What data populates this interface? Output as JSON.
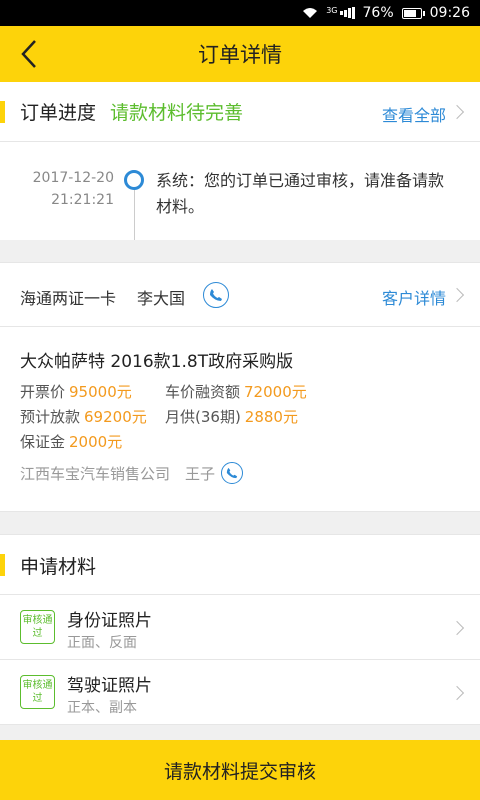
{
  "status_bar": {
    "network": "3G",
    "battery": "76%",
    "time": "09:26"
  },
  "nav": {
    "title": "订单详情",
    "back_icon": "chevron-left-icon"
  },
  "progress": {
    "label": "订单进度",
    "status": "请款材料待完善",
    "view_all": "查看全部",
    "colors": {
      "status": "#5cbd2e",
      "link": "#2d8ad6"
    }
  },
  "timeline": {
    "date": "2017-12-20",
    "time": "21:21:21",
    "message": "系统：您的订单已通过审核，请准备请款材料。"
  },
  "customer": {
    "org": "海通两证一卡",
    "name": "李大国",
    "detail_link": "客户详情",
    "car": "大众帕萨特 2016款1.8T政府采购版",
    "fields": {
      "invoice_label": "开票价",
      "invoice_value": "95000元",
      "finance_label": "车价融资额",
      "finance_value": "72000元",
      "loan_label": "预计放款",
      "loan_value": "69200元",
      "monthly_label": "月供(36期)",
      "monthly_value": "2880元",
      "deposit_label": "保证金",
      "deposit_value": "2000元"
    },
    "dealer": "江西车宝汽车销售公司",
    "salesman": "王子"
  },
  "materials": {
    "label": "申请材料",
    "items": [
      {
        "badge": "审核通过",
        "name": "身份证照片",
        "sub": "正面、反面"
      },
      {
        "badge": "审核通过",
        "name": "驾驶证照片",
        "sub": "正本、副本"
      }
    ]
  },
  "submit_label": "请款材料提交审核",
  "theme": {
    "accent": "#fdd30a",
    "amount": "#f39a1e"
  }
}
